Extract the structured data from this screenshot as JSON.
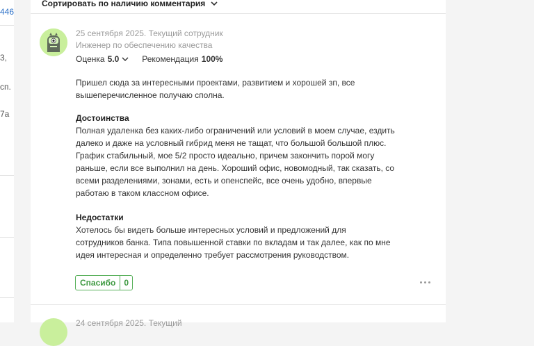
{
  "sort": {
    "label": "Сортировать по наличию комментария"
  },
  "left_fragments": [
    "446",
    "3,",
    "сп.",
    "7а"
  ],
  "review": {
    "date": "25 сентября 2025. Текущий сотрудник",
    "position": "Инженер по обеспечению качества",
    "rating_label": "Оценка",
    "rating_value": "5.0",
    "recommend_label": "Рекомендация",
    "recommend_value": "100%",
    "intro": "Пришел сюда за интересными проектами, развитием и хорошей зп, все вышеперечисленное получаю сполна.",
    "pros_title": "Достоинства",
    "pros_text": "Полная удаленка без каких-либо ограничений или условий в моем случае, ездить далеко и даже на условный гибрид меня не тащат, что большой большой плюс. График стабильный, мое 5/2 просто идеально, причем закончить порой могу раньше, если все выполнил на день. Хороший офис, новомодный, так сказать, со всеми разделениями, зонами, есть и опенспейс, все очень удобно, впервые работаю в таком классном офисе.",
    "cons_title": "Недостатки",
    "cons_text": "Хотелось бы видеть больше интересных условий и предложений для сотрудников банка. Типа повышенной ставки по вкладам и так далее, как по мне идея интересная и определенно требует рассмотрения руководством.",
    "thanks_label": "Спасибо",
    "thanks_count": "0"
  },
  "next_review": {
    "date_partial": "24 сентября 2025. Текущий"
  },
  "colors": {
    "accent_green": "#58b05a",
    "link_blue": "#2a6fc7",
    "avatar_bg": "#c9ef9c"
  },
  "icons": [
    "chevron-down-icon",
    "avatar-monster-icon",
    "more-dots-icon"
  ]
}
